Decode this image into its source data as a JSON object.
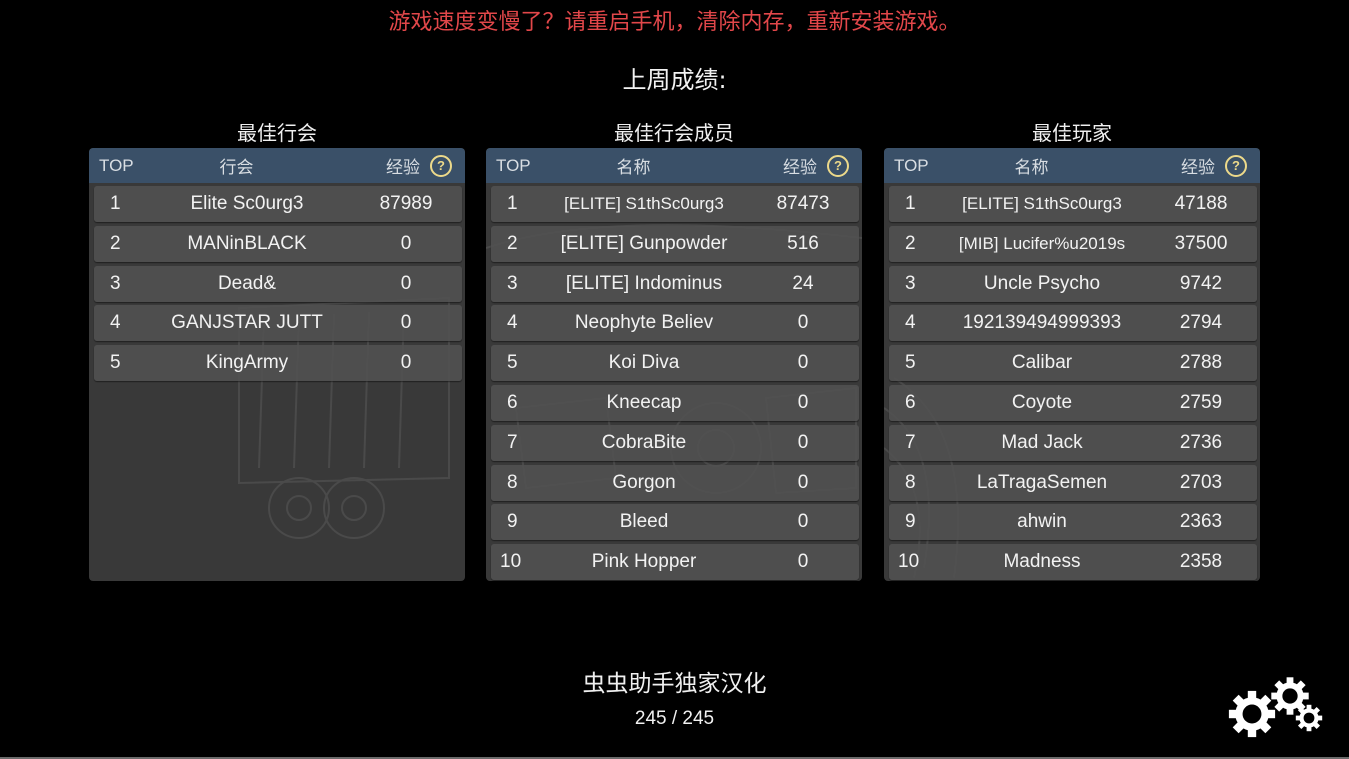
{
  "warning": "游戏速度变慢了？请重启手机，清除内存，重新安装游戏。",
  "week_title": "上周成绩:",
  "colors": {
    "warning": "#e2474a",
    "header_bg": "#3a5068",
    "panel_bg": "#393939",
    "row_bg": "#505050",
    "help_icon": "#ecd98a"
  },
  "panels": [
    {
      "title": "最佳行会",
      "header": {
        "top": "TOP",
        "name": "行会",
        "xp": "经验",
        "help_icon": "question-circle-icon"
      },
      "rows": [
        {
          "rank": "1",
          "name": "Elite Sc0urg3",
          "xp": "87989"
        },
        {
          "rank": "2",
          "name": "MANinBLACK",
          "xp": "0"
        },
        {
          "rank": "3",
          "name": "Dead&",
          "xp": "0"
        },
        {
          "rank": "4",
          "name": "GANJSTAR JUTT",
          "xp": "0"
        },
        {
          "rank": "5",
          "name": "KingArmy",
          "xp": "0"
        }
      ]
    },
    {
      "title": "最佳行会成员",
      "header": {
        "top": "TOP",
        "name": "名称",
        "xp": "经验",
        "help_icon": "question-circle-icon"
      },
      "rows": [
        {
          "rank": "1",
          "name": "[ELITE] S1thSc0urg3",
          "xp": "87473"
        },
        {
          "rank": "2",
          "name": "[ELITE] Gunpowder",
          "xp": "516"
        },
        {
          "rank": "3",
          "name": "[ELITE] Indominus",
          "xp": "24"
        },
        {
          "rank": "4",
          "name": "Neophyte Believ",
          "xp": "0"
        },
        {
          "rank": "5",
          "name": "Koi Diva",
          "xp": "0"
        },
        {
          "rank": "6",
          "name": "Kneecap",
          "xp": "0"
        },
        {
          "rank": "7",
          "name": "CobraBite",
          "xp": "0"
        },
        {
          "rank": "8",
          "name": "Gorgon",
          "xp": "0"
        },
        {
          "rank": "9",
          "name": "Bleed",
          "xp": "0"
        },
        {
          "rank": "10",
          "name": "Pink Hopper",
          "xp": "0"
        }
      ]
    },
    {
      "title": "最佳玩家",
      "header": {
        "top": "TOP",
        "name": "名称",
        "xp": "经验",
        "help_icon": "question-circle-icon"
      },
      "rows": [
        {
          "rank": "1",
          "name": "[ELITE] S1thSc0urg3",
          "xp": "47188"
        },
        {
          "rank": "2",
          "name": "[MIB] Lucifer%u2019s",
          "xp": "37500"
        },
        {
          "rank": "3",
          "name": "Uncle Psycho",
          "xp": "9742"
        },
        {
          "rank": "4",
          "name": "192139494999393",
          "xp": "2794"
        },
        {
          "rank": "5",
          "name": "Calibar",
          "xp": "2788"
        },
        {
          "rank": "6",
          "name": "Coyote",
          "xp": "2759"
        },
        {
          "rank": "7",
          "name": "Mad Jack",
          "xp": "2736"
        },
        {
          "rank": "8",
          "name": "LaTragaSemen",
          "xp": "2703"
        },
        {
          "rank": "9",
          "name": "ahwin",
          "xp": "2363"
        },
        {
          "rank": "10",
          "name": "Madness",
          "xp": "2358"
        }
      ]
    }
  ],
  "credit": "虫虫助手独家汉化",
  "pager": "245 / 245",
  "settings_icon": "gears-icon"
}
